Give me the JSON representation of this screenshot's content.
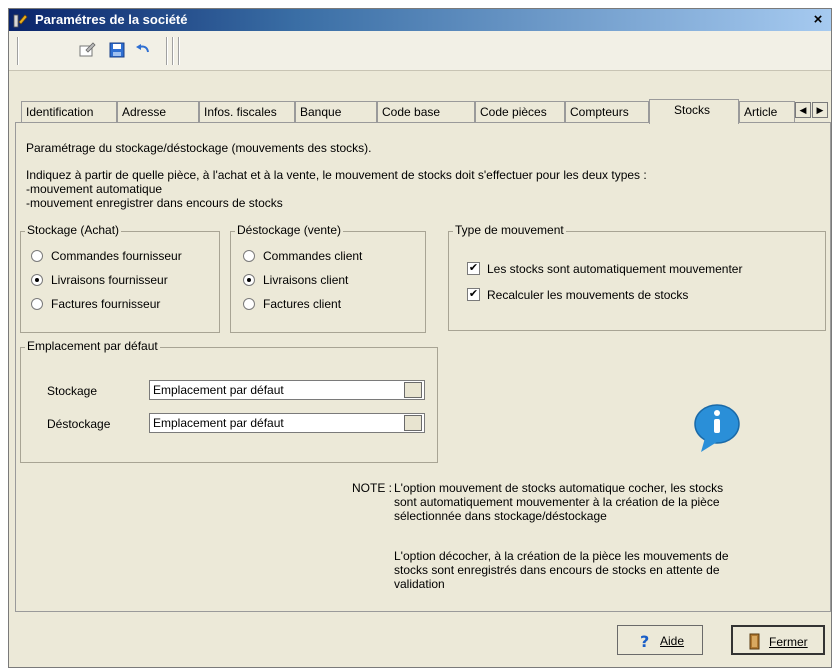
{
  "window": {
    "title": "Paramétres de la société",
    "close_glyph": "×"
  },
  "tabs": [
    {
      "label": "Identification"
    },
    {
      "label": "Adresse"
    },
    {
      "label": "Infos. fiscales"
    },
    {
      "label": "Banque"
    },
    {
      "label": "Code base"
    },
    {
      "label": "Code pièces"
    },
    {
      "label": "Compteurs"
    },
    {
      "label": "Stocks"
    },
    {
      "label": "Article"
    }
  ],
  "panel": {
    "intro": "Paramétrage du stockage/déstockage (mouvements des stocks).",
    "instruction_line1": "Indiquez à partir de quelle pièce, à l'achat et à la vente,  le mouvement de stocks doit s'effectuer pour les deux types :",
    "instruction_line2": "-mouvement automatique",
    "instruction_line3": "-mouvement enregistrer dans encours de stocks"
  },
  "stockage": {
    "title": "Stockage  (Achat)",
    "options": [
      {
        "label": "Commandes fournisseur",
        "selected": false
      },
      {
        "label": "Livraisons fournisseur",
        "selected": true
      },
      {
        "label": "Factures fournisseur",
        "selected": false
      }
    ]
  },
  "destockage": {
    "title": "Déstockage (vente)",
    "options": [
      {
        "label": "Commandes client",
        "selected": false
      },
      {
        "label": "Livraisons client",
        "selected": true
      },
      {
        "label": "Factures client",
        "selected": false
      }
    ]
  },
  "type_mouvement": {
    "title": "Type de mouvement",
    "checkbox1": {
      "label": "Les stocks sont automatiquement  mouvementer",
      "checked": true
    },
    "checkbox2": {
      "label": "Recalculer les mouvements de stocks",
      "checked": true
    }
  },
  "emplacement": {
    "title": "Emplacement par défaut",
    "stockage_label": "Stockage",
    "stockage_value": "Emplacement par défaut",
    "destockage_label": "Déstockage",
    "destockage_value": "Emplacement par défaut"
  },
  "note": {
    "prefix": "NOTE :",
    "line1": "L'option mouvement de stocks automatique cocher, les stocks",
    "line2": "sont automatiquement mouvementer à la création de la pièce",
    "line3": "sélectionnée dans stockage/déstockage",
    "line4": "L'option décocher, à la création de la pièce les mouvements de",
    "line5": "stocks sont enregistrés dans  encours de stocks en attente de",
    "line6": "validation"
  },
  "footer": {
    "help_label": "Aide",
    "close_label": "Fermer"
  },
  "colors": {
    "window_bg": "#ece9d8",
    "title_bar": "#0a246a",
    "info_icon": "#2a8fd8"
  }
}
